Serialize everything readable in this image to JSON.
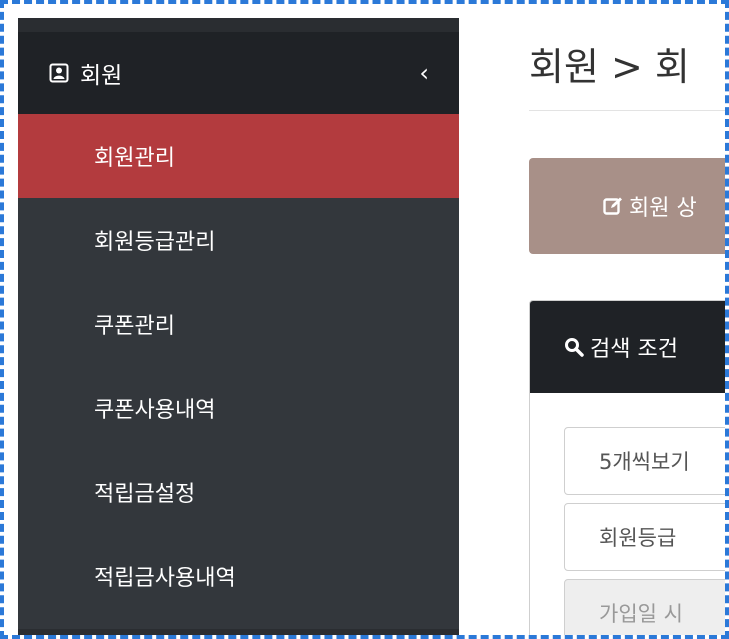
{
  "sidebar": {
    "section_label": "회원",
    "items": [
      {
        "label": "회원관리",
        "active": true
      },
      {
        "label": "회원등급관리",
        "active": false
      },
      {
        "label": "쿠폰관리",
        "active": false
      },
      {
        "label": "쿠폰사용내역",
        "active": false
      },
      {
        "label": "적립금설정",
        "active": false
      },
      {
        "label": "적립금사용내역",
        "active": false
      }
    ],
    "icons": {
      "section": "contact-card-icon",
      "collapse": "chevron-left-icon"
    }
  },
  "main": {
    "page_title": "회원 > 회",
    "edit_button_label": "회원 상",
    "search_panel_title": "검색 조건",
    "fields": [
      {
        "value": "5개씩보기"
      },
      {
        "value": "회원등급"
      },
      {
        "placeholder": "가입일 시"
      }
    ]
  },
  "colors": {
    "sidebar_bg": "#33373c",
    "active_item": "#b33b3e",
    "edit_button": "#a89088",
    "panel_header": "#1f2226",
    "frame_border": "#2b79d8"
  }
}
